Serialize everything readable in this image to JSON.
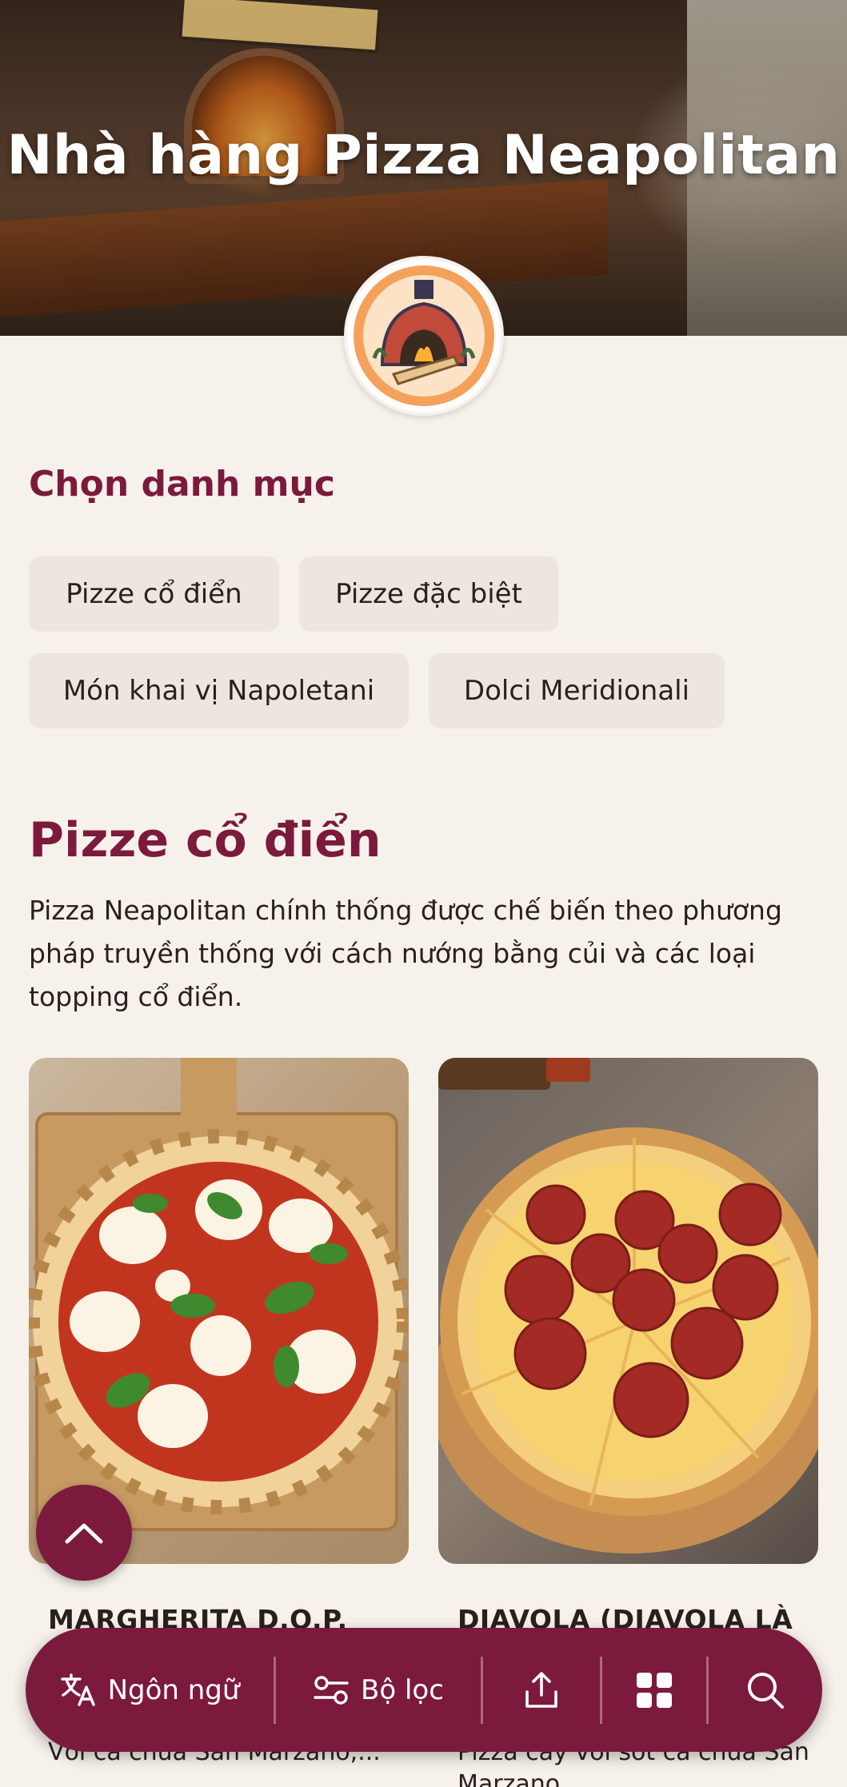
{
  "hero": {
    "title": "Nhà hàng Pizza Neapolitan",
    "logo_icon": "pizza-oven-logo"
  },
  "categories": {
    "heading": "Chọn danh mục",
    "items": [
      {
        "label": "Pizze cổ điển"
      },
      {
        "label": "Pizze đặc biệt"
      },
      {
        "label": "Món khai vị Napoletani"
      },
      {
        "label": "Dolci Meridionali"
      }
    ]
  },
  "section": {
    "title": "Pizze cổ điển",
    "description": "Pizza Neapolitan chính thống được chế biến theo phương pháp truyền thống với cách nướng bằng củi và các loại topping cổ điển."
  },
  "products": [
    {
      "title": "MARGHERITA D.O.P.",
      "description": "Với cà chua San Marzano,...",
      "image_icon": "margherita-pizza"
    },
    {
      "title": "DIAVOLA (DIAVOLA LÀ",
      "description": "Pizza cay với sốt cà chua San Marzano...",
      "image_icon": "pepperoni-pizza"
    }
  ],
  "bottom_nav": {
    "language_label": "Ngôn ngữ",
    "filter_label": "Bộ lọc",
    "share_icon": "share-icon",
    "grid_icon": "grid-icon",
    "search_icon": "search-icon"
  },
  "colors": {
    "accent": "#7b1a3c",
    "background": "#f6f1ea",
    "chip": "#ece6df"
  }
}
